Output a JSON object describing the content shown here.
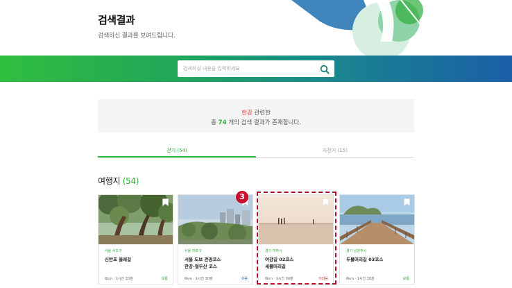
{
  "header": {
    "title": "검색결과",
    "subtitle": "검색하신 결과를 보여드립니다."
  },
  "search": {
    "placeholder": "검색하실 내용을 입력하세요"
  },
  "summary": {
    "keyword": "한강",
    "line1_suffix": " 관련한",
    "line2_prefix": "총 ",
    "count": "74",
    "line2_suffix": " 개의 검색 결과가 존재합니다."
  },
  "tabs": [
    {
      "label": "걷기 (54)"
    },
    {
      "label": "자전거 (15)"
    }
  ],
  "section": {
    "title": "여행지 ",
    "count": "(54)"
  },
  "badge": {
    "label": "3"
  },
  "cards": [
    {
      "region": "서울 서초구",
      "name_line1": "신반포 올레길",
      "name_line2": "",
      "meta": "6km · 1시간 30분",
      "level": "보통",
      "level_color": "#2fae3a"
    },
    {
      "region": "서울 마포구",
      "name_line1": "서울 도보 관광코스",
      "name_line2": "한강-절두산 코스",
      "meta": "6km · 1시간 30분",
      "level": "쉬움",
      "level_color": "#1e6fd0"
    },
    {
      "region": "경기 여주시",
      "name_line1": "여강길 02코스",
      "name_line2": "세물머리길",
      "meta": "6km · 1시간 30분",
      "level": "어려움",
      "level_color": "#e53935"
    },
    {
      "region": "경기 남양주시",
      "name_line1": "두물머리길 03코스",
      "name_line2": "",
      "meta": "6km · 1시간 30분",
      "level": "보통",
      "level_color": "#2fae3a"
    }
  ],
  "colors": {
    "accent_green": "#2fae3a",
    "keyword_red": "#e53935",
    "highlight": "#b0102a"
  }
}
